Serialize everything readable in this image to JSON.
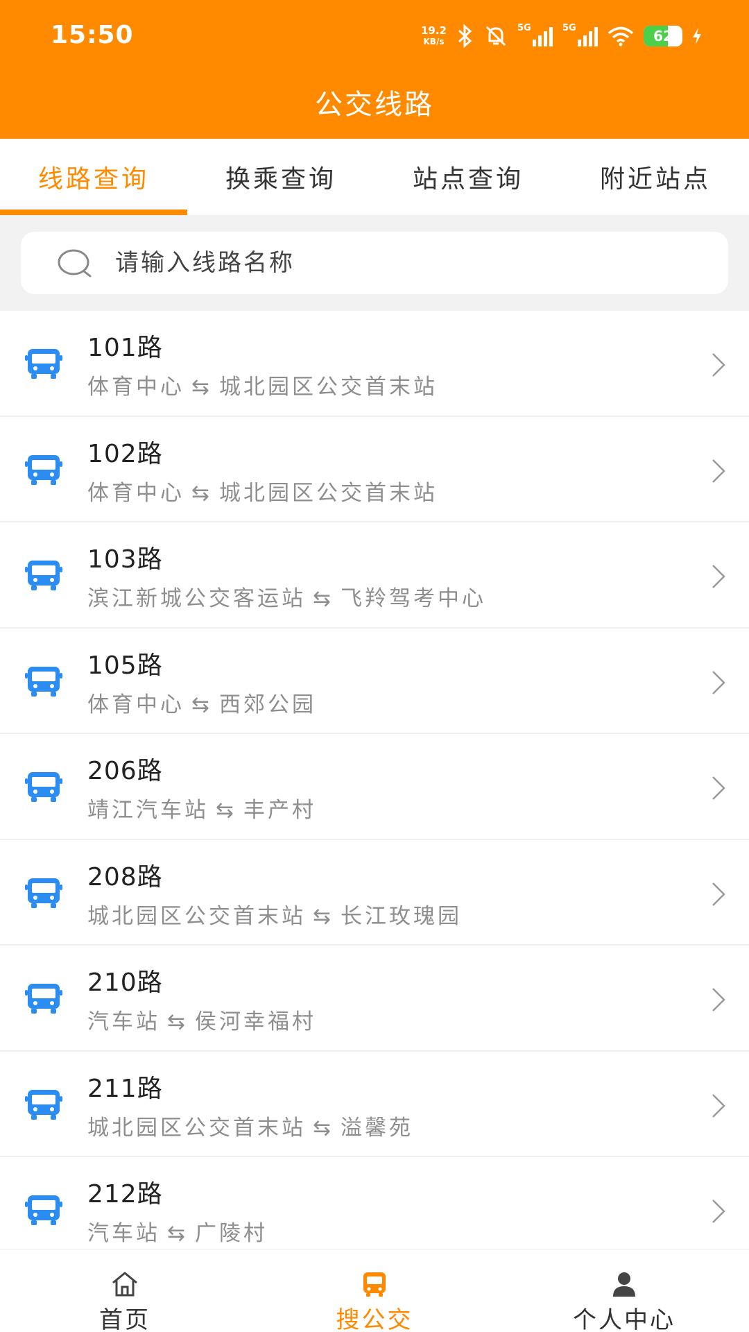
{
  "status_bar": {
    "time": "15:50",
    "net_speed_value": "19.2",
    "net_speed_unit": "KB/s",
    "signal1_label": "5G",
    "signal2_label": "5G",
    "battery_level": "62",
    "icons": [
      "bluetooth-icon",
      "mute-bell-icon",
      "signal-5g-icon",
      "signal-5g-icon",
      "wifi-icon",
      "battery-icon",
      "charging-icon"
    ]
  },
  "header": {
    "title": "公交线路"
  },
  "tabs": [
    {
      "label": "线路查询",
      "active": true
    },
    {
      "label": "换乘查询",
      "active": false
    },
    {
      "label": "站点查询",
      "active": false
    },
    {
      "label": "附近站点",
      "active": false
    }
  ],
  "search": {
    "placeholder": "请输入线路名称",
    "value": ""
  },
  "routes": [
    {
      "name": "101路",
      "from": "体育中心",
      "to": "城北园区公交首末站"
    },
    {
      "name": "102路",
      "from": "体育中心",
      "to": "城北园区公交首末站"
    },
    {
      "name": "103路",
      "from": "滨江新城公交客运站",
      "to": "飞羚驾考中心"
    },
    {
      "name": "105路",
      "from": "体育中心",
      "to": "西郊公园"
    },
    {
      "name": "206路",
      "from": "靖江汽车站",
      "to": "丰产村"
    },
    {
      "name": "208路",
      "from": "城北园区公交首末站",
      "to": "长江玫瑰园"
    },
    {
      "name": "210路",
      "from": "汽车站",
      "to": "侯河幸福村"
    },
    {
      "name": "211路",
      "from": "城北园区公交首末站",
      "to": "溢馨苑"
    },
    {
      "name": "212路",
      "from": "汽车站",
      "to": "广陵村"
    }
  ],
  "swap_symbol": "⇆",
  "bottom_nav": [
    {
      "label": "首页",
      "icon": "home-icon",
      "active": false
    },
    {
      "label": "搜公交",
      "icon": "bus-icon",
      "active": true
    },
    {
      "label": "个人中心",
      "icon": "person-icon",
      "active": false
    }
  ],
  "colors": {
    "accent": "#FF8A00",
    "bus_icon": "#2B8CF2",
    "secondary_text": "#8E8E8E",
    "battery_green": "#4CD04C"
  }
}
